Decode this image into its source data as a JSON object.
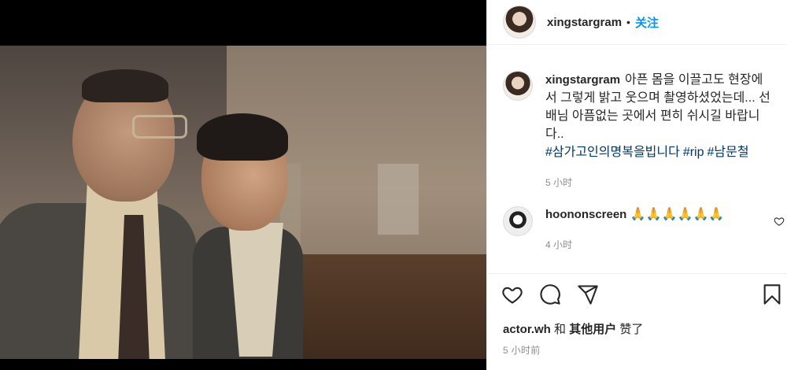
{
  "post": {
    "username": "xingstargram",
    "dot": "•",
    "follow_label": "关注"
  },
  "caption": {
    "username": "xingstargram",
    "text": "아픈 몸을 이끌고도 현장에서 그렇게 밝고 웃으며 촬영하셨었는데... 선배님 아픔없는 곳에서 편히 쉬시길 바랍니다..",
    "hashtags": [
      "#삼가고인의명복을빕니다",
      "#rip",
      "#남문철"
    ],
    "time": "5 小时"
  },
  "comment": {
    "username": "hoononscreen",
    "text": "🙏🙏🙏🙏🙏🙏",
    "time": "4 小时"
  },
  "likes": {
    "user": "actor.wh",
    "and": "和",
    "others": "其他用户",
    "suffix": "赞了"
  },
  "posted_ago": "5 小时前",
  "icons": [
    "heart-icon",
    "comment-icon",
    "share-icon",
    "bookmark-icon",
    "comment-like-icon"
  ],
  "colors": {
    "link": "#0095f6",
    "hashtag": "#00376b",
    "muted": "#8e8e8e"
  }
}
